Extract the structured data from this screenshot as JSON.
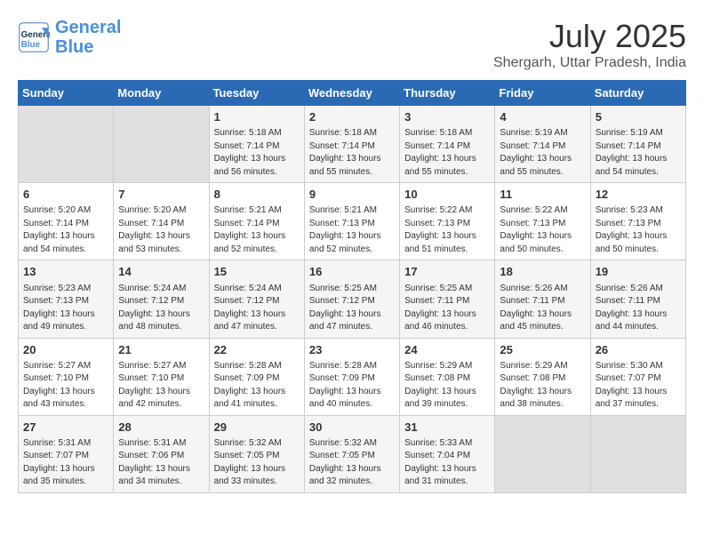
{
  "header": {
    "logo_line1": "General",
    "logo_line2": "Blue",
    "month_year": "July 2025",
    "location": "Shergarh, Uttar Pradesh, India"
  },
  "days_of_week": [
    "Sunday",
    "Monday",
    "Tuesday",
    "Wednesday",
    "Thursday",
    "Friday",
    "Saturday"
  ],
  "weeks": [
    [
      {
        "day": "",
        "empty": true
      },
      {
        "day": "",
        "empty": true
      },
      {
        "day": "1",
        "sunrise": "5:18 AM",
        "sunset": "7:14 PM",
        "daylight": "13 hours and 56 minutes."
      },
      {
        "day": "2",
        "sunrise": "5:18 AM",
        "sunset": "7:14 PM",
        "daylight": "13 hours and 55 minutes."
      },
      {
        "day": "3",
        "sunrise": "5:18 AM",
        "sunset": "7:14 PM",
        "daylight": "13 hours and 55 minutes."
      },
      {
        "day": "4",
        "sunrise": "5:19 AM",
        "sunset": "7:14 PM",
        "daylight": "13 hours and 55 minutes."
      },
      {
        "day": "5",
        "sunrise": "5:19 AM",
        "sunset": "7:14 PM",
        "daylight": "13 hours and 54 minutes."
      }
    ],
    [
      {
        "day": "6",
        "sunrise": "5:20 AM",
        "sunset": "7:14 PM",
        "daylight": "13 hours and 54 minutes."
      },
      {
        "day": "7",
        "sunrise": "5:20 AM",
        "sunset": "7:14 PM",
        "daylight": "13 hours and 53 minutes."
      },
      {
        "day": "8",
        "sunrise": "5:21 AM",
        "sunset": "7:14 PM",
        "daylight": "13 hours and 52 minutes."
      },
      {
        "day": "9",
        "sunrise": "5:21 AM",
        "sunset": "7:13 PM",
        "daylight": "13 hours and 52 minutes."
      },
      {
        "day": "10",
        "sunrise": "5:22 AM",
        "sunset": "7:13 PM",
        "daylight": "13 hours and 51 minutes."
      },
      {
        "day": "11",
        "sunrise": "5:22 AM",
        "sunset": "7:13 PM",
        "daylight": "13 hours and 50 minutes."
      },
      {
        "day": "12",
        "sunrise": "5:23 AM",
        "sunset": "7:13 PM",
        "daylight": "13 hours and 50 minutes."
      }
    ],
    [
      {
        "day": "13",
        "sunrise": "5:23 AM",
        "sunset": "7:13 PM",
        "daylight": "13 hours and 49 minutes."
      },
      {
        "day": "14",
        "sunrise": "5:24 AM",
        "sunset": "7:12 PM",
        "daylight": "13 hours and 48 minutes."
      },
      {
        "day": "15",
        "sunrise": "5:24 AM",
        "sunset": "7:12 PM",
        "daylight": "13 hours and 47 minutes."
      },
      {
        "day": "16",
        "sunrise": "5:25 AM",
        "sunset": "7:12 PM",
        "daylight": "13 hours and 47 minutes."
      },
      {
        "day": "17",
        "sunrise": "5:25 AM",
        "sunset": "7:11 PM",
        "daylight": "13 hours and 46 minutes."
      },
      {
        "day": "18",
        "sunrise": "5:26 AM",
        "sunset": "7:11 PM",
        "daylight": "13 hours and 45 minutes."
      },
      {
        "day": "19",
        "sunrise": "5:26 AM",
        "sunset": "7:11 PM",
        "daylight": "13 hours and 44 minutes."
      }
    ],
    [
      {
        "day": "20",
        "sunrise": "5:27 AM",
        "sunset": "7:10 PM",
        "daylight": "13 hours and 43 minutes."
      },
      {
        "day": "21",
        "sunrise": "5:27 AM",
        "sunset": "7:10 PM",
        "daylight": "13 hours and 42 minutes."
      },
      {
        "day": "22",
        "sunrise": "5:28 AM",
        "sunset": "7:09 PM",
        "daylight": "13 hours and 41 minutes."
      },
      {
        "day": "23",
        "sunrise": "5:28 AM",
        "sunset": "7:09 PM",
        "daylight": "13 hours and 40 minutes."
      },
      {
        "day": "24",
        "sunrise": "5:29 AM",
        "sunset": "7:08 PM",
        "daylight": "13 hours and 39 minutes."
      },
      {
        "day": "25",
        "sunrise": "5:29 AM",
        "sunset": "7:08 PM",
        "daylight": "13 hours and 38 minutes."
      },
      {
        "day": "26",
        "sunrise": "5:30 AM",
        "sunset": "7:07 PM",
        "daylight": "13 hours and 37 minutes."
      }
    ],
    [
      {
        "day": "27",
        "sunrise": "5:31 AM",
        "sunset": "7:07 PM",
        "daylight": "13 hours and 35 minutes."
      },
      {
        "day": "28",
        "sunrise": "5:31 AM",
        "sunset": "7:06 PM",
        "daylight": "13 hours and 34 minutes."
      },
      {
        "day": "29",
        "sunrise": "5:32 AM",
        "sunset": "7:05 PM",
        "daylight": "13 hours and 33 minutes."
      },
      {
        "day": "30",
        "sunrise": "5:32 AM",
        "sunset": "7:05 PM",
        "daylight": "13 hours and 32 minutes."
      },
      {
        "day": "31",
        "sunrise": "5:33 AM",
        "sunset": "7:04 PM",
        "daylight": "13 hours and 31 minutes."
      },
      {
        "day": "",
        "empty": true
      },
      {
        "day": "",
        "empty": true
      }
    ]
  ]
}
